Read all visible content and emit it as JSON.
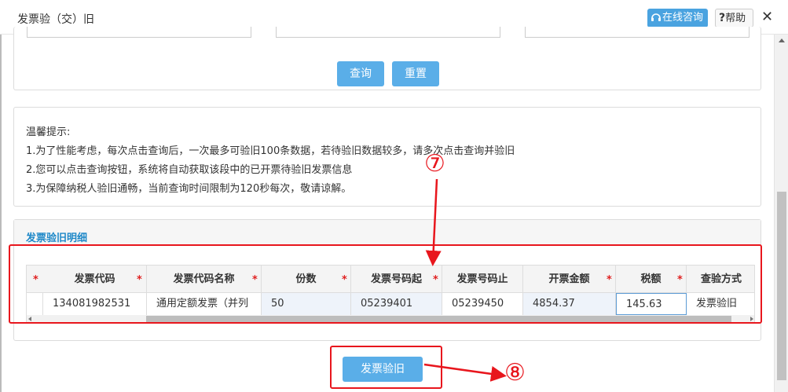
{
  "dialog": {
    "title": "发票验（交）旧",
    "online_consult_label": "在线咨询",
    "help_label": "帮助",
    "help_symbol": "?",
    "close_symbol": "✕"
  },
  "query": {
    "query_button": "查询",
    "reset_button": "重置"
  },
  "tips": {
    "heading": "温馨提示:",
    "lines": [
      "1.为了性能考虑，每次点击查询后，一次最多可验旧100条数据，若待验旧数据较多，请多次点击查询并验旧",
      "2.您可以点击查询按钮，系统将自动获取该段中的已开票待验旧发票信息",
      "3.为保障纳税人验旧通畅，当前查询时间限制为120秒每次，敬请谅解。"
    ]
  },
  "detail": {
    "title": "发票验旧明细",
    "columns": [
      "发票代码",
      "发票代码名称",
      "份数",
      "发票号码起",
      "发票号码止",
      "开票金额",
      "税额",
      "查验方式"
    ],
    "required_star": "*",
    "rows": [
      {
        "code": "134081982531",
        "code_name": "通用定额发票（并列",
        "count": "50",
        "start_no": "05239401",
        "end_no": "05239450",
        "amount": "4854.37",
        "tax": "145.63",
        "method": "发票验旧"
      }
    ]
  },
  "submit_button": "发票验旧",
  "annotations": {
    "marker_7": "⑦",
    "marker_8": "⑧",
    "highlight_color": "#e8161d"
  },
  "colors": {
    "primary_button": "#5aaee8",
    "title_blue": "#1e88c8"
  }
}
